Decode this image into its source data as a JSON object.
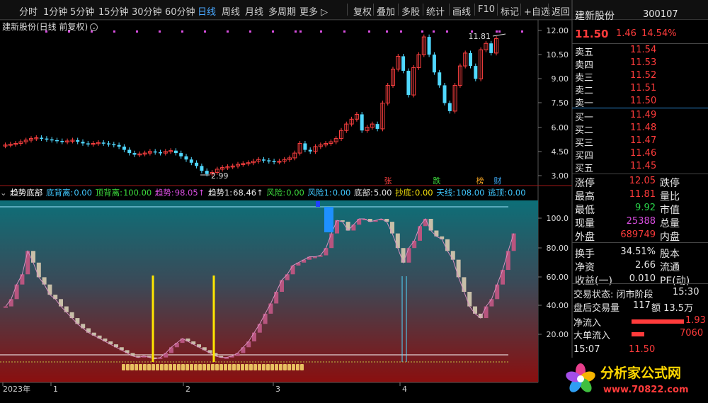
{
  "toolbar": {
    "periods": [
      "分时",
      "1分钟",
      "5分钟",
      "15分钟",
      "30分钟",
      "60分钟",
      "日线",
      "周线",
      "月线",
      "多周期",
      "更多 ▷"
    ],
    "active_period": "日线",
    "tools": [
      "复权",
      "叠加",
      "多股",
      "统计",
      "画线",
      "F10",
      "标记",
      "+自选",
      "返回"
    ]
  },
  "main_chart": {
    "title": "建新股份(日线 前复权)",
    "settings_glyph": "⌄",
    "y_ticks": [
      "12.00",
      "10.50",
      "9.00",
      "7.50",
      "6.00",
      "4.50",
      "3.00"
    ],
    "high_label": "11.81",
    "low_label": "2.99",
    "markers": [
      {
        "text": "张",
        "color": "#ff4040"
      },
      {
        "text": "跌",
        "color": "#40e040"
      },
      {
        "text": "榜",
        "color": "#f0a020"
      },
      {
        "text": "财",
        "color": "#40b0ff"
      }
    ]
  },
  "indicator": {
    "name": "趋势底部",
    "items": [
      {
        "label": "底背离:",
        "value": "0.00",
        "color": "#40c8ff"
      },
      {
        "label": "顶背离:",
        "value": "100.00",
        "color": "#3ddc3d"
      },
      {
        "label": "趋势:",
        "value": "98.05↑",
        "color": "#d84ee0"
      },
      {
        "label": "趋势1:",
        "value": "68.46↑",
        "color": "#e6e6e6"
      },
      {
        "label": "风险:",
        "value": "0.00",
        "color": "#3ddc3d"
      },
      {
        "label": "风险1:",
        "value": "0.00",
        "color": "#40c8ff"
      },
      {
        "label": "底部:",
        "value": "5.00",
        "color": "#e6e6e6"
      },
      {
        "label": "抄底:",
        "value": "0.00",
        "color": "#f5e20b"
      },
      {
        "label": "天线:",
        "value": "108.00",
        "color": "#40c8ff"
      },
      {
        "label": "逃顶:",
        "value": "0.00",
        "color": "#40c8ff"
      }
    ],
    "y_ticks": [
      "100.0",
      "80.00",
      "60.00",
      "40.00",
      "20.00"
    ]
  },
  "time_axis": [
    "2023年",
    "1",
    "2",
    "3",
    "4"
  ],
  "quote": {
    "name": "建新股份",
    "code": "300107",
    "price": "11.50",
    "change": "1.46",
    "pct": "14.54%",
    "asks": [
      {
        "label": "卖五",
        "price": "11.54"
      },
      {
        "label": "卖四",
        "price": "11.53"
      },
      {
        "label": "卖三",
        "price": "11.52"
      },
      {
        "label": "卖二",
        "price": "11.51"
      },
      {
        "label": "卖一",
        "price": "11.50"
      }
    ],
    "bids": [
      {
        "label": "买一",
        "price": "11.49"
      },
      {
        "label": "买二",
        "price": "11.48"
      },
      {
        "label": "买三",
        "price": "11.47"
      },
      {
        "label": "买四",
        "price": "11.46"
      },
      {
        "label": "买五",
        "price": "11.45"
      }
    ],
    "stats": [
      {
        "l1": "涨停",
        "v1": "12.05",
        "c1": "#ff3b3b",
        "l2": "跌停"
      },
      {
        "l1": "最高",
        "v1": "11.81",
        "c1": "#ff3b3b",
        "l2": "量比"
      },
      {
        "l1": "最低",
        "v1": "9.92",
        "c1": "#29d44a",
        "l2": "市值"
      },
      {
        "l1": "现量",
        "v1": "25388",
        "c1": "#d84ee0",
        "l2": "总量"
      },
      {
        "l1": "外盘",
        "v1": "689749",
        "c1": "#ff3b3b",
        "l2": "内盘"
      },
      {
        "l1": "换手",
        "v1": "34.51%",
        "c1": "#e6e6e6",
        "l2": "股本"
      },
      {
        "l1": "净资",
        "v1": "2.66",
        "c1": "#e6e6e6",
        "l2": "流通"
      },
      {
        "l1": "收益(一)",
        "v1": "0.010",
        "c1": "#e6e6e6",
        "l2": "PE(动)"
      }
    ],
    "trade_status": "交易状态: 闭市阶段",
    "trade_time": "15:30",
    "after_hours": "盘后交易量",
    "after_vol": "117",
    "after_amt": "额 13.5万",
    "net_in_label": "净流入",
    "net_in": "1.93",
    "big_in_label": "大单流入",
    "big_in": "7060",
    "last_time": "15:07",
    "last_price": "11.50"
  },
  "watermark": {
    "text": "分析家公式网",
    "url": "www.70822.com"
  }
}
